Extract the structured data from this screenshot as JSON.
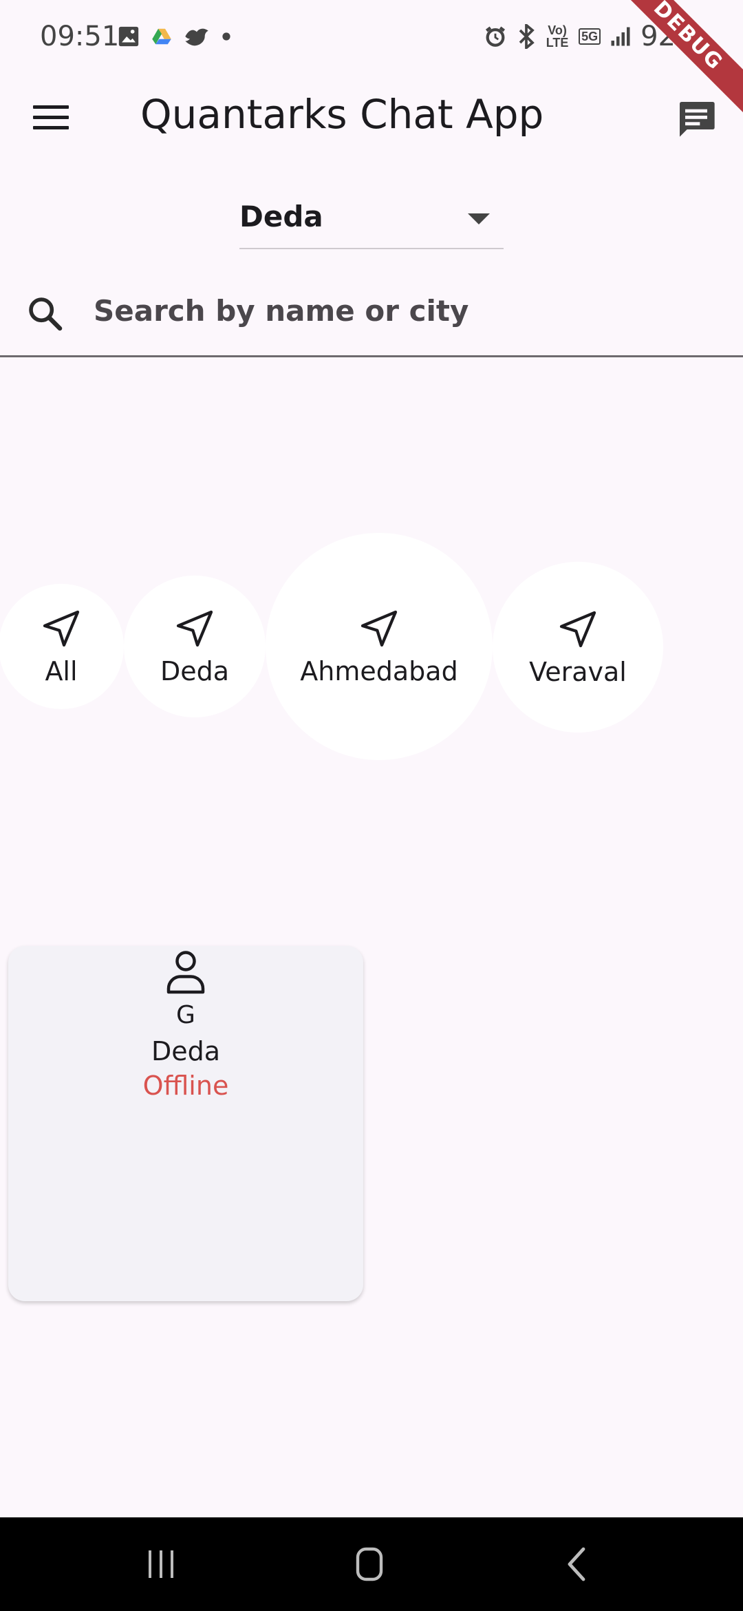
{
  "status_bar": {
    "time": "09:51",
    "battery": "92%",
    "signal_label": "5G",
    "volte_label": "Vo) LTE"
  },
  "debug": {
    "label": "DEBUG"
  },
  "app_bar": {
    "title": "Quantarks Chat App"
  },
  "dropdown": {
    "selected": "Deda"
  },
  "search": {
    "placeholder": "Search by name or city",
    "value": ""
  },
  "cities": [
    {
      "label": "All"
    },
    {
      "label": "Deda"
    },
    {
      "label": "Ahmedabad"
    },
    {
      "label": "Veraval"
    }
  ],
  "user_card": {
    "initial": "G",
    "city": "Deda",
    "status": "Offline",
    "status_color": "#d9534f"
  },
  "colors": {
    "background": "#fcf7fc",
    "ribbon": "#b3373e"
  }
}
